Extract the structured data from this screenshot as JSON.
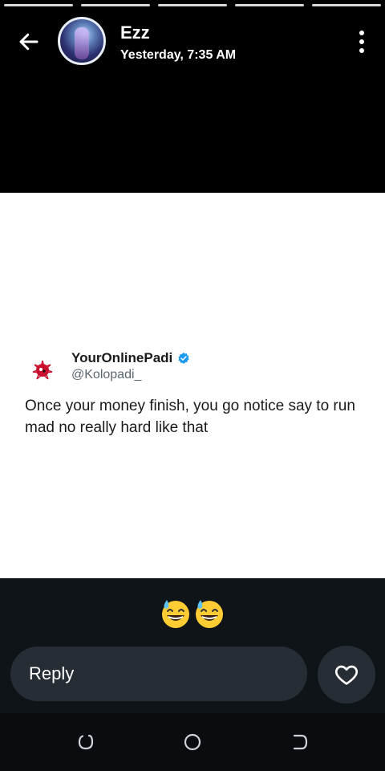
{
  "story": {
    "segments": 5,
    "author_name": "Ezz",
    "timestamp": "Yesterday, 7:35 AM"
  },
  "tweet": {
    "display_name": "YourOnlinePadi",
    "handle": "@Kolopadi_",
    "text": "Once your money finish, you go notice say to run mad no really hard like that"
  },
  "reaction": {
    "emojis": [
      "😅",
      "😅"
    ]
  },
  "reply": {
    "placeholder": "Reply"
  },
  "colors": {
    "verified": "#1d9bf0",
    "bottom_bg": "#0f1419",
    "pill_bg": "#262d35"
  }
}
